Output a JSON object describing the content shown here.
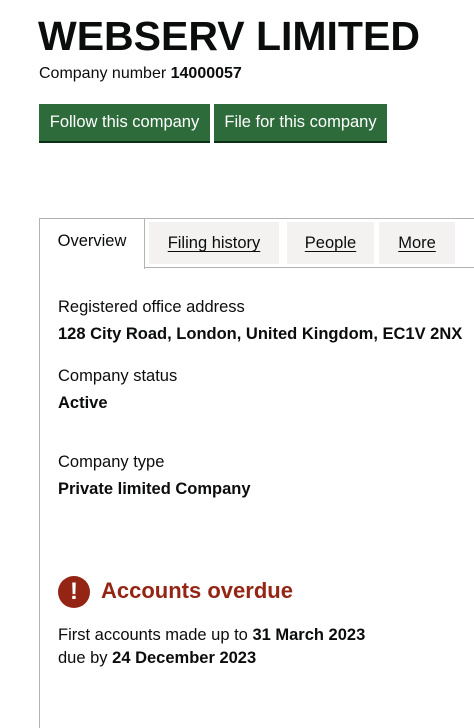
{
  "company": {
    "name": "WEBSERV LIMITED",
    "number_label": "Company number",
    "number": "14000057"
  },
  "actions": {
    "follow_label": "Follow this company",
    "file_label": "File for this company"
  },
  "tabs": [
    {
      "label": "Overview",
      "active": true
    },
    {
      "label": "Filing history",
      "active": false
    },
    {
      "label": "People",
      "active": false
    },
    {
      "label": "More",
      "active": false
    }
  ],
  "overview": {
    "registered_office_label": "Registered office address",
    "registered_office_value": "128 City Road, London, United Kingdom, EC1V 2NX",
    "status_label": "Company status",
    "status_value": "Active",
    "type_label": "Company type",
    "type_value": "Private limited Company"
  },
  "accounts": {
    "warning_icon": "!",
    "warning_title": "Accounts overdue",
    "first_accounts_text": "First accounts made up to",
    "first_accounts_date": "31 March 2023",
    "due_text": "due by",
    "due_date": "24 December 2023"
  },
  "colors": {
    "button_green": "#2e6b3b",
    "warning_red": "#942514",
    "tab_background": "#f3f2f1",
    "border_grey": "#b1b4b6"
  }
}
